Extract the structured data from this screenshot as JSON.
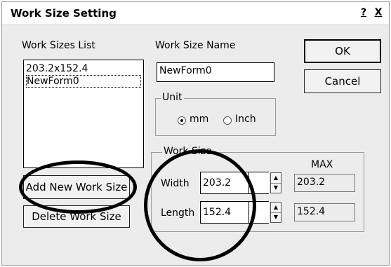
{
  "dialog": {
    "title": "Work Size Setting",
    "help_label": "?",
    "close_label": "X"
  },
  "work_sizes": {
    "label": "Work Sizes List",
    "items": [
      "203.2x152.4",
      "NewForm0"
    ],
    "selected": "NewForm0",
    "add_button": "Add New Work Size",
    "delete_button": "Delete Work Size"
  },
  "work_size_name": {
    "label": "Work Size Name",
    "value": "NewForm0"
  },
  "buttons": {
    "ok": "OK",
    "cancel": "Cancel"
  },
  "unit": {
    "label": "Unit",
    "options": [
      "mm",
      "Inch"
    ],
    "selected": "mm"
  },
  "work_size": {
    "label": "Work Size",
    "max_label": "MAX",
    "width_label": "Width",
    "width_value": "203.2",
    "width_max": "203.2",
    "length_label": "Length",
    "length_value": "152.4",
    "length_max": "152.4"
  }
}
